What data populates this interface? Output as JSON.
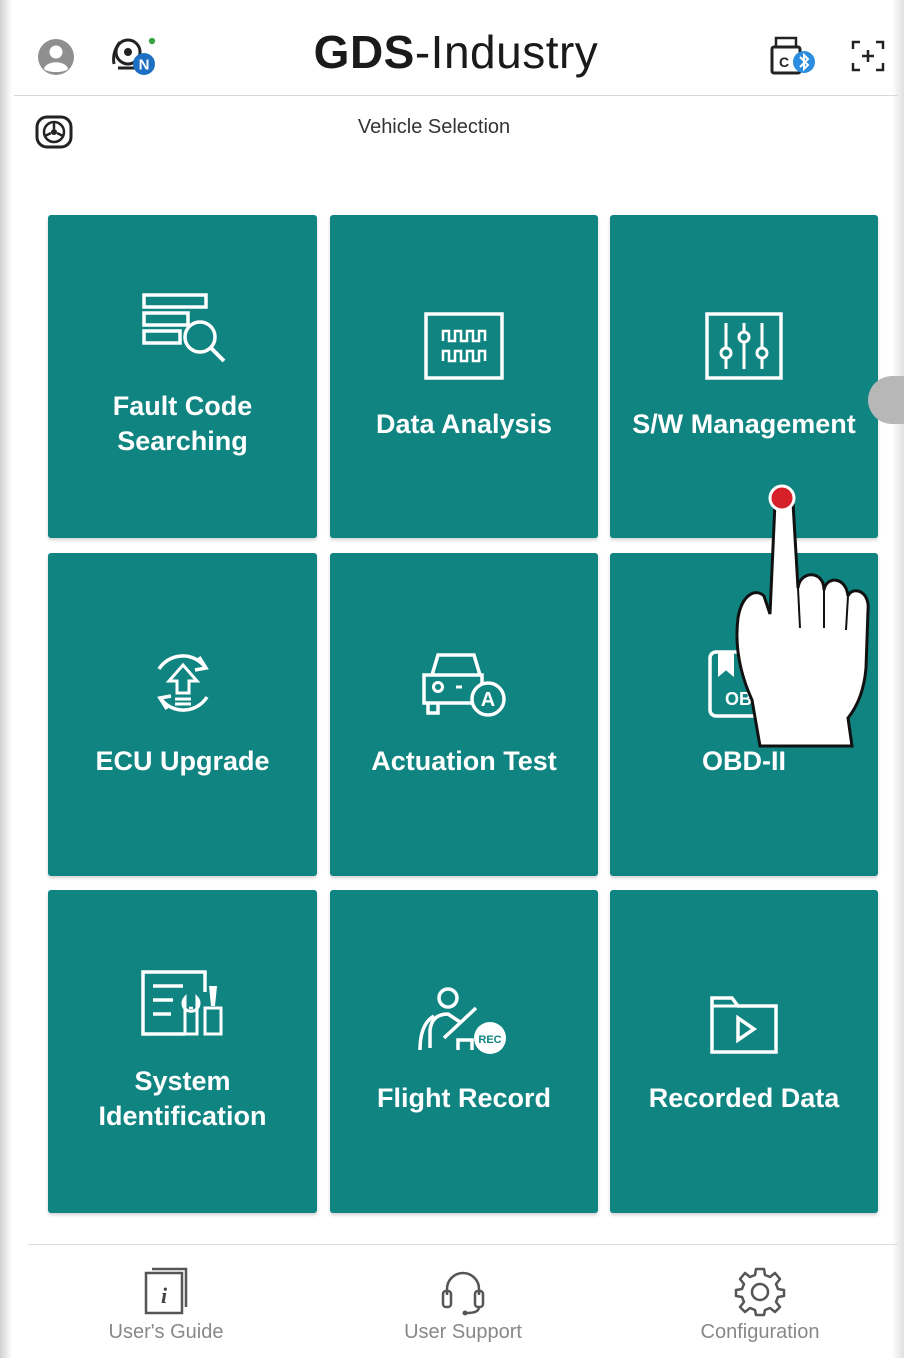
{
  "header": {
    "logo_bold": "GDS",
    "logo_light": "-Industry",
    "profile_icon": "profile-icon",
    "vci_icon": "vci-connection-icon",
    "vci_badge": "N",
    "usb_bluetooth_icon": "usb-bluetooth-icon",
    "fullscreen_icon": "fullscreen-icon"
  },
  "subbar": {
    "title": "Vehicle Selection",
    "wheel_icon": "steering-wheel-icon"
  },
  "tiles": [
    {
      "label": "Fault Code\nSearching",
      "icon": "fault-code-search-icon"
    },
    {
      "label": "Data Analysis",
      "icon": "data-analysis-icon"
    },
    {
      "label": "S/W Management",
      "icon": "sw-management-icon"
    },
    {
      "label": "ECU Upgrade",
      "icon": "ecu-upgrade-icon"
    },
    {
      "label": "Actuation Test",
      "icon": "actuation-test-icon"
    },
    {
      "label": "OBD-II",
      "icon": "obd-icon",
      "icon_text": "OBD"
    },
    {
      "label": "System\nIdentification",
      "icon": "system-identification-icon"
    },
    {
      "label": "Flight Record",
      "icon": "flight-record-icon",
      "icon_text": "REC"
    },
    {
      "label": "Recorded Data",
      "icon": "recorded-data-icon"
    }
  ],
  "footer": {
    "users_guide": "User's Guide",
    "user_support": "User Support",
    "configuration": "Configuration",
    "guide_glyph": "i"
  },
  "colors": {
    "tile": "#0f8481",
    "tap_indicator": "#d6202a",
    "text_gray": "#888888"
  }
}
